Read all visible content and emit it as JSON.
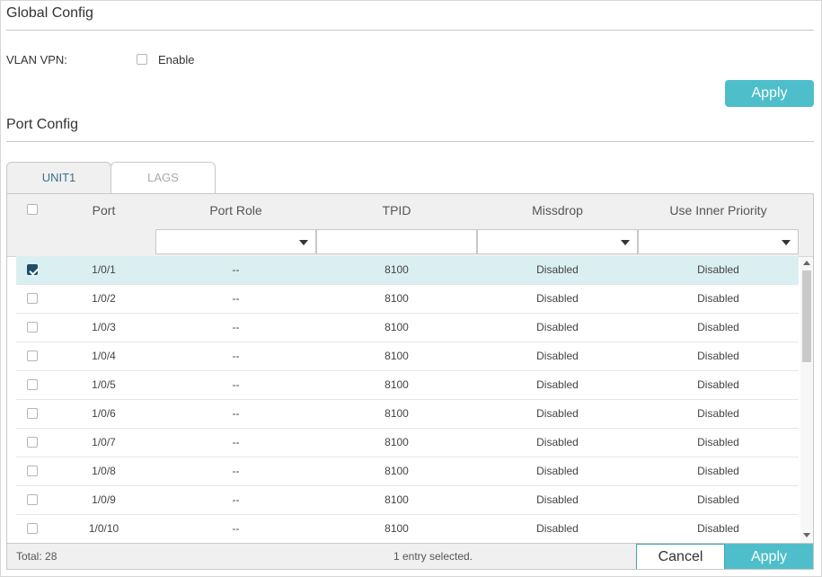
{
  "global": {
    "title": "Global Config",
    "vlan_vpn_label": "VLAN VPN:",
    "enable_label": "Enable",
    "apply_label": "Apply"
  },
  "port_config": {
    "title": "Port Config",
    "tabs": [
      "UNIT1",
      "LAGS"
    ],
    "active_tab": "UNIT1"
  },
  "table": {
    "columns": [
      "Port",
      "Port Role",
      "TPID",
      "Missdrop",
      "Use Inner Priority"
    ],
    "rows": [
      {
        "port": "1/0/1",
        "role": "--",
        "tpid": "8100",
        "missdrop": "Disabled",
        "inner": "Disabled",
        "selected": true
      },
      {
        "port": "1/0/2",
        "role": "--",
        "tpid": "8100",
        "missdrop": "Disabled",
        "inner": "Disabled",
        "selected": false
      },
      {
        "port": "1/0/3",
        "role": "--",
        "tpid": "8100",
        "missdrop": "Disabled",
        "inner": "Disabled",
        "selected": false
      },
      {
        "port": "1/0/4",
        "role": "--",
        "tpid": "8100",
        "missdrop": "Disabled",
        "inner": "Disabled",
        "selected": false
      },
      {
        "port": "1/0/5",
        "role": "--",
        "tpid": "8100",
        "missdrop": "Disabled",
        "inner": "Disabled",
        "selected": false
      },
      {
        "port": "1/0/6",
        "role": "--",
        "tpid": "8100",
        "missdrop": "Disabled",
        "inner": "Disabled",
        "selected": false
      },
      {
        "port": "1/0/7",
        "role": "--",
        "tpid": "8100",
        "missdrop": "Disabled",
        "inner": "Disabled",
        "selected": false
      },
      {
        "port": "1/0/8",
        "role": "--",
        "tpid": "8100",
        "missdrop": "Disabled",
        "inner": "Disabled",
        "selected": false
      },
      {
        "port": "1/0/9",
        "role": "--",
        "tpid": "8100",
        "missdrop": "Disabled",
        "inner": "Disabled",
        "selected": false
      },
      {
        "port": "1/0/10",
        "role": "--",
        "tpid": "8100",
        "missdrop": "Disabled",
        "inner": "Disabled",
        "selected": false
      }
    ],
    "total": "Total: 28",
    "selected_text": "1 entry selected.",
    "cancel_label": "Cancel",
    "apply_label": "Apply"
  },
  "colors": {
    "accent": "#4ebfca",
    "check": "#1f4f6a",
    "selected_row": "#daeff1"
  }
}
